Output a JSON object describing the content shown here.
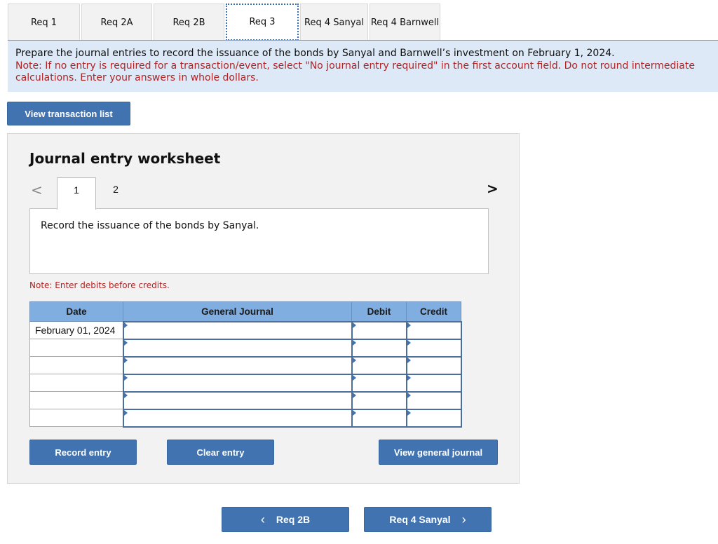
{
  "tabs": [
    {
      "label": "Req 1",
      "active": false
    },
    {
      "label": "Req 2A",
      "active": false
    },
    {
      "label": "Req 2B",
      "active": false
    },
    {
      "label": "Req 3",
      "active": true
    },
    {
      "label": "Req 4 Sanyal",
      "active": false
    },
    {
      "label": "Req 4 Barnwell",
      "active": false
    }
  ],
  "instructions": {
    "main": "Prepare the journal entries to record the issuance of the bonds by Sanyal and Barnwell’s investment on February 1, 2024.",
    "note": "Note: If no entry is required for a transaction/event, select \"No journal entry required\" in the first account field. Do not round intermediate calculations. Enter your answers in whole dollars."
  },
  "view_transaction_list_label": "View transaction list",
  "worksheet": {
    "title": "Journal entry worksheet",
    "prev_icon": "chevron-left",
    "next_icon": "chevron-right",
    "pages": [
      "1",
      "2"
    ],
    "active_page": "1",
    "description": "Record the issuance of the bonds by Sanyal.",
    "debit_note": "Note: Enter debits before credits.",
    "table": {
      "headers": [
        "Date",
        "General Journal",
        "Debit",
        "Credit"
      ],
      "rows": [
        {
          "date": "February 01, 2024",
          "account": "",
          "debit": "",
          "credit": ""
        },
        {
          "date": "",
          "account": "",
          "debit": "",
          "credit": ""
        },
        {
          "date": "",
          "account": "",
          "debit": "",
          "credit": ""
        },
        {
          "date": "",
          "account": "",
          "debit": "",
          "credit": ""
        },
        {
          "date": "",
          "account": "",
          "debit": "",
          "credit": ""
        },
        {
          "date": "",
          "account": "",
          "debit": "",
          "credit": ""
        }
      ]
    },
    "buttons": {
      "record": "Record entry",
      "clear": "Clear entry",
      "view_journal": "View general journal"
    }
  },
  "nav": {
    "prev_label": "Req 2B",
    "next_label": "Req 4 Sanyal",
    "prev_icon": "‹",
    "next_icon": "›"
  },
  "colors": {
    "accent": "#4273b1",
    "note_red": "#b22323",
    "instruction_bg": "#dde9f7",
    "table_header": "#80aee0"
  }
}
